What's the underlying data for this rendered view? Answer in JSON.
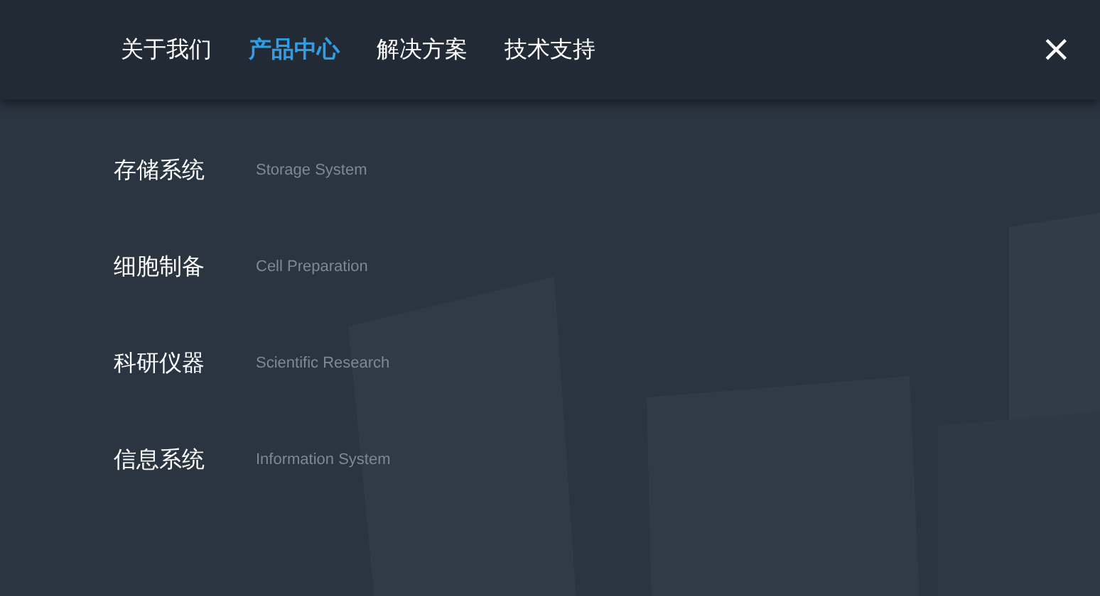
{
  "nav": {
    "tabs": [
      {
        "label": "关于我们",
        "selected": false
      },
      {
        "label": "产品中心",
        "selected": true
      },
      {
        "label": "解决方案",
        "selected": false
      },
      {
        "label": "技术支持",
        "selected": false
      }
    ],
    "close": "×"
  },
  "categories": [
    {
      "name": "存储系统",
      "english": "Storage System"
    },
    {
      "name": "细胞制备",
      "english": "Cell Preparation"
    },
    {
      "name": "科研仪器",
      "english": "Scientific Research"
    },
    {
      "name": "信息系统",
      "english": "Information System"
    }
  ]
}
